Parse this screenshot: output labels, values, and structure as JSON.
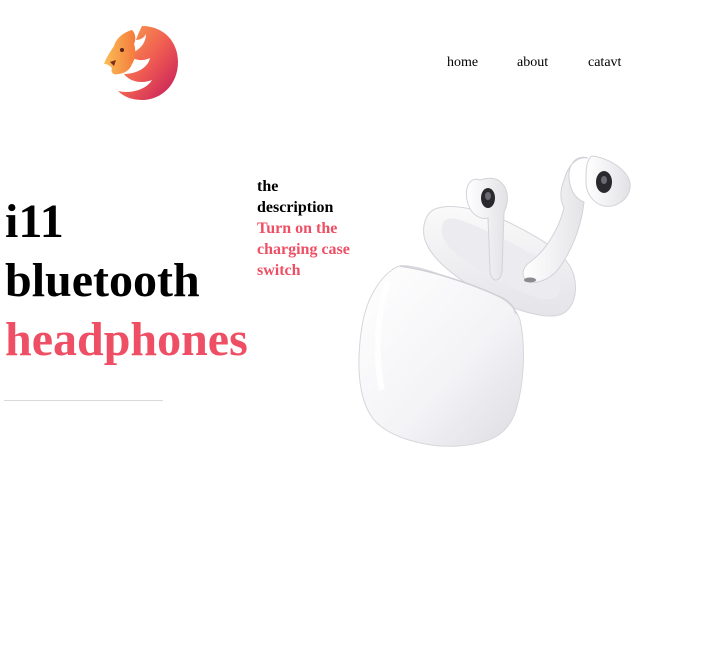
{
  "nav": {
    "items": [
      "home",
      "about",
      "catavt"
    ]
  },
  "hero": {
    "line1": "i11",
    "line2": "bluetooth",
    "line3": "headphones"
  },
  "description": {
    "title": "the description",
    "body": "Turn on the charging case switch"
  },
  "colors": {
    "accent": "#ef4f64",
    "text": "#000000"
  },
  "icons": {
    "logo": "lion-logo-icon",
    "product": "earbuds-case-image"
  }
}
